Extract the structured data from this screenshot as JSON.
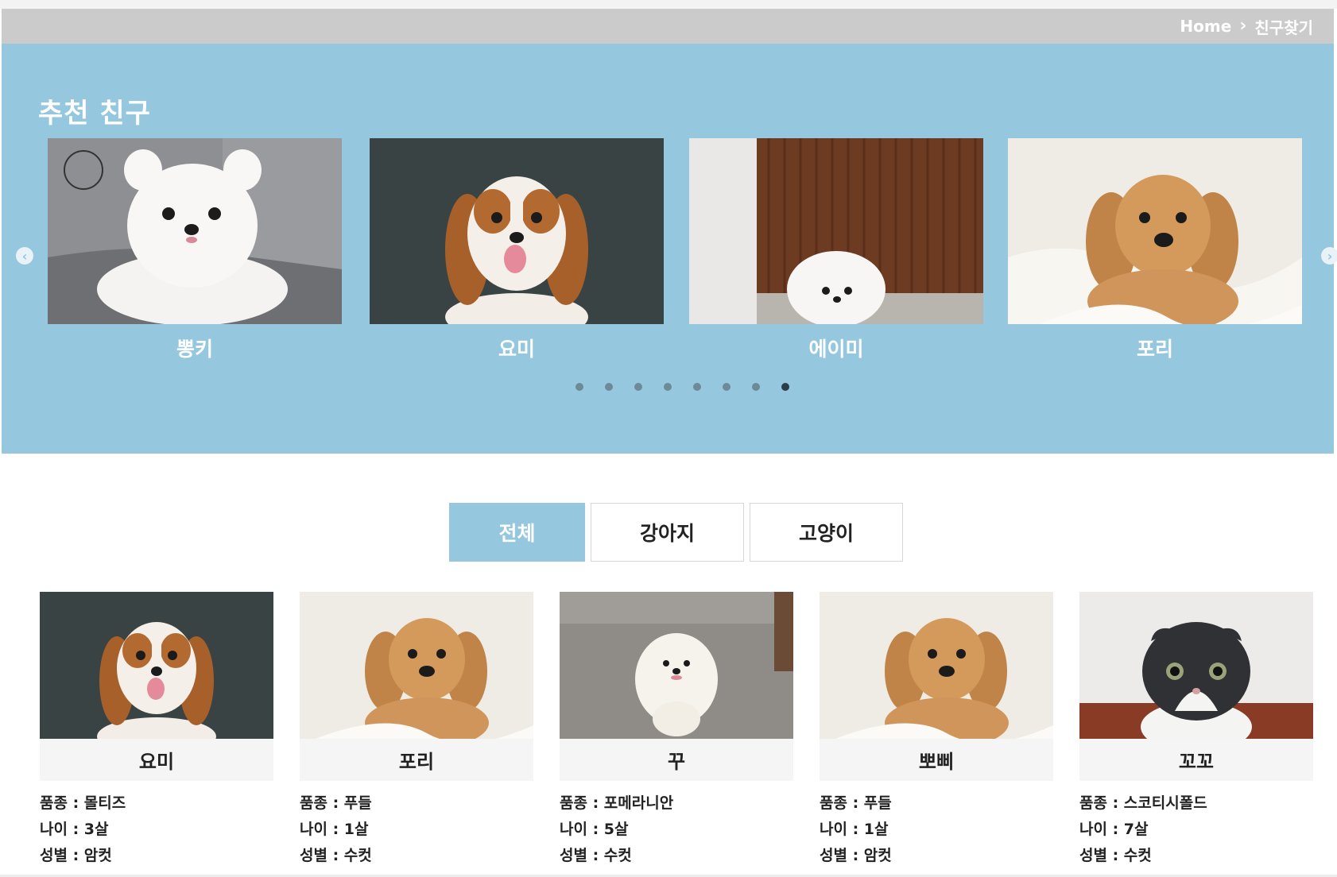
{
  "breadcrumb": {
    "home": "Home",
    "separator": "›",
    "current": "친구찾기"
  },
  "recommend": {
    "title": "추천 친구",
    "prev_icon": "chevron-left-icon",
    "next_icon": "chevron-right-icon",
    "slides": [
      {
        "name": "뽕키",
        "photo": "white-pomeranian-on-sofa"
      },
      {
        "name": "요미",
        "photo": "cavalier-spaniel-dark-background"
      },
      {
        "name": "에이미",
        "photo": "white-puppy-brown-wall"
      },
      {
        "name": "포리",
        "photo": "golden-dachshund-on-blanket"
      }
    ],
    "dot_count": 8,
    "active_dot": 8
  },
  "tabs": [
    {
      "label": "전체",
      "active": true
    },
    {
      "label": "강아지",
      "active": false
    },
    {
      "label": "고양이",
      "active": false
    }
  ],
  "friends": [
    {
      "name": "요미",
      "breed": "품종 : 몰티즈",
      "age": "나이 : 3살",
      "sex": "성별 : 암컷",
      "photo": "cavalier-spaniel-dark-background"
    },
    {
      "name": "포리",
      "breed": "품종 : 푸들",
      "age": "나이 : 1살",
      "sex": "성별 : 수컷",
      "photo": "golden-dachshund-on-blanket"
    },
    {
      "name": "꾸",
      "breed": "품종 : 포메라니안",
      "age": "나이 : 5살",
      "sex": "성별 : 수컷",
      "photo": "white-pomeranian-on-pavement"
    },
    {
      "name": "뽀삐",
      "breed": "품종 : 푸들",
      "age": "나이 : 1살",
      "sex": "성별 : 암컷",
      "photo": "golden-dachshund-on-blanket"
    },
    {
      "name": "꼬꼬",
      "breed": "품종 : 스코티시폴드",
      "age": "나이 : 7살",
      "sex": "성별 : 수컷",
      "photo": "scottish-fold-cat"
    }
  ],
  "colors": {
    "accent": "#95c7df",
    "breadcrumb_bg": "#cbcbcb",
    "name_bg": "#f5f5f5"
  }
}
